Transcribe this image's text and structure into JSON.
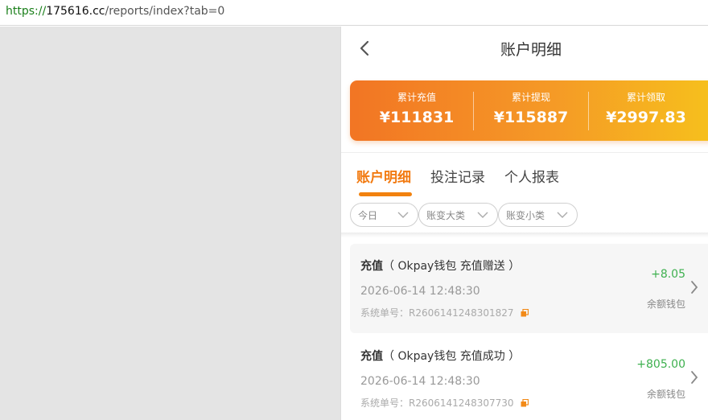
{
  "browser": {
    "url_scheme": "https://",
    "url_host": "175616.cc",
    "url_path": "/reports/index?tab=0"
  },
  "header": {
    "title": "账户明细"
  },
  "summary": {
    "recharge_label": "累计充值",
    "recharge_value": "¥111831",
    "withdraw_label": "累计提现",
    "withdraw_value": "¥115887",
    "claim_label": "累计领取",
    "claim_value": "¥2997.83",
    "gradient_start": "#f27524",
    "gradient_end": "#f6c21c"
  },
  "tabs": [
    {
      "label": "账户明细",
      "active": true
    },
    {
      "label": "投注记录",
      "active": false
    },
    {
      "label": "个人报表",
      "active": false
    }
  ],
  "filters": [
    {
      "label": "今日",
      "icon": "chevron-down-icon"
    },
    {
      "label": "账变大类",
      "icon": "chevron-down-icon"
    },
    {
      "label": "账变小类",
      "icon": "chevron-down-icon"
    }
  ],
  "records": [
    {
      "kind": "充值",
      "detail": "（ Okpay钱包 充值赠送 ）",
      "time": "2026-06-14 12:48:30",
      "order_label": "系统单号：",
      "order_no": "R2606141248301827",
      "amount": "+8.05",
      "wallet": "余额钱包"
    },
    {
      "kind": "充值",
      "detail": "（ Okpay钱包 充值成功 ）",
      "time": "2026-06-14 12:48:30",
      "order_label": "系统单号：",
      "order_no": "R2606141248307730",
      "amount": "+805.00",
      "wallet": "余额钱包"
    }
  ],
  "colors": {
    "accent": "#f27a10",
    "amount_positive": "#3eb04f"
  }
}
